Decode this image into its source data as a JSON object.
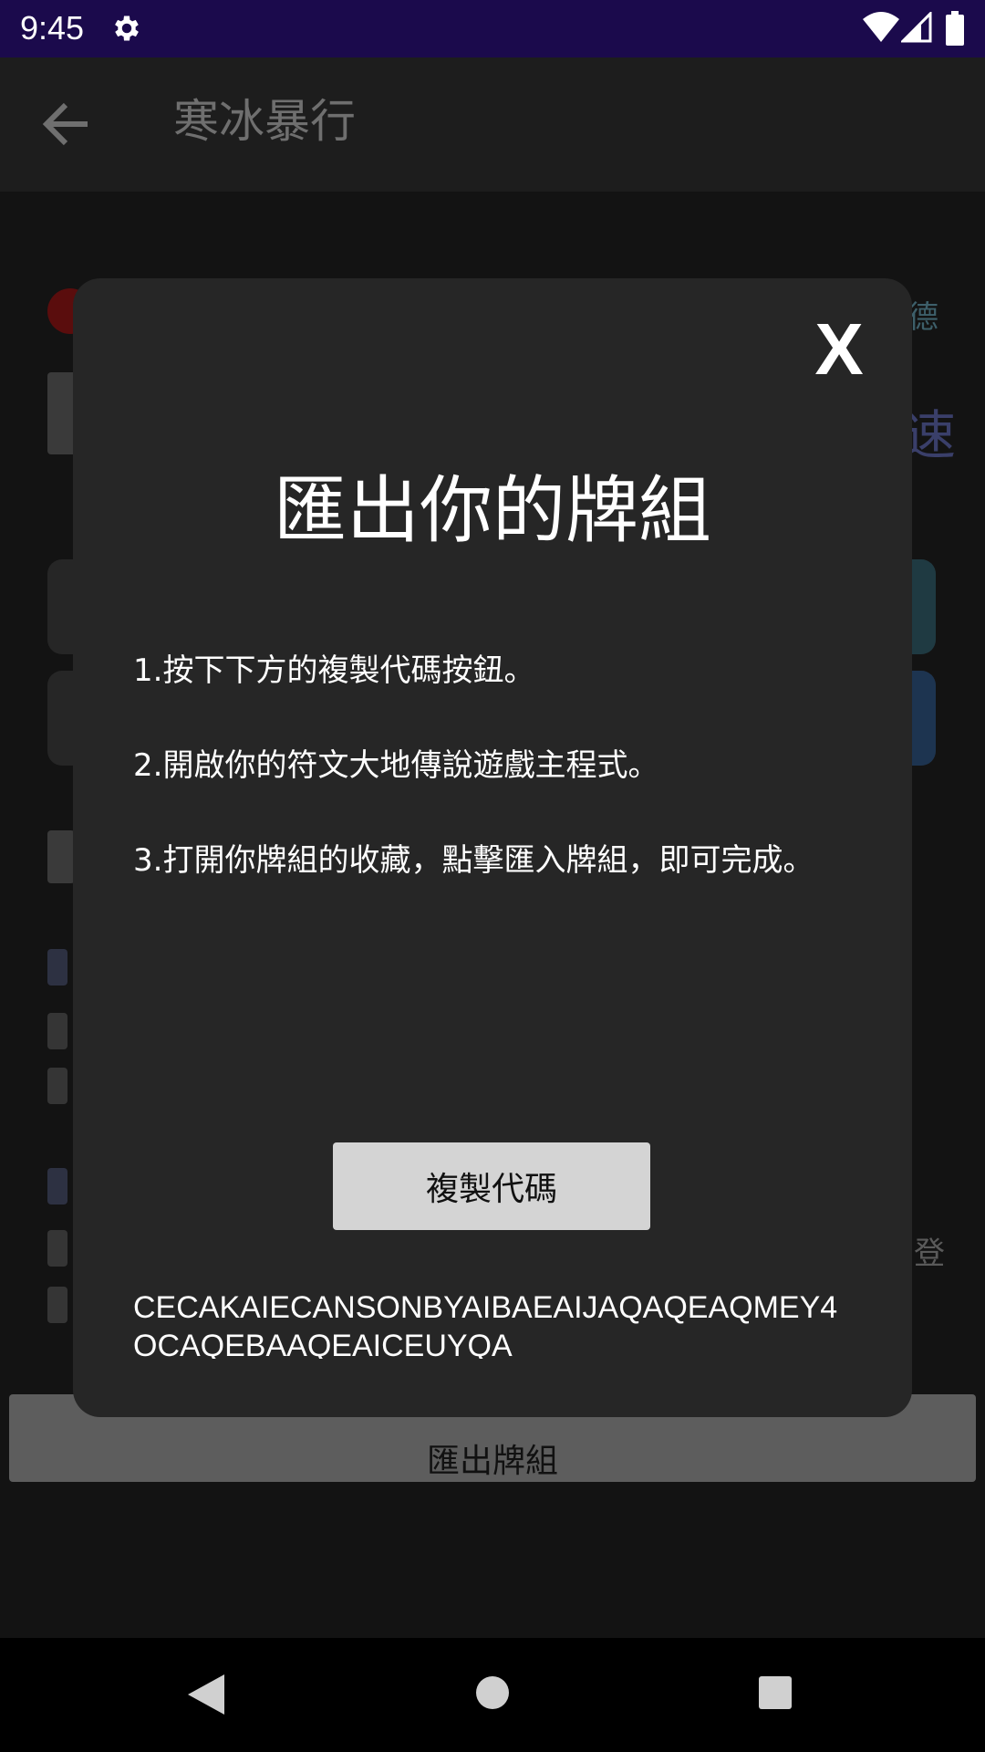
{
  "status_bar": {
    "time": "9:45",
    "icons": [
      "settings-gear-icon",
      "wifi-icon",
      "cell-signal-icon",
      "battery-icon"
    ]
  },
  "app_bar": {
    "title": "寒冰暴行",
    "back_icon": "arrow-left-icon"
  },
  "background": {
    "right_label": "德",
    "right_char": "速",
    "right_tail": "登",
    "export_button_label": "匯出牌組"
  },
  "dialog": {
    "close_label": "X",
    "title": "匯出你的牌組",
    "steps": [
      "1.按下下方的複製代碼按鈕。",
      "2.開啟你的符文大地傳說遊戲主程式。",
      "3.打開你牌組的收藏，點擊匯入牌組，即可完成。"
    ],
    "copy_button_label": "複製代碼",
    "deck_code": "CECAKAIECANSONBYAIBAEAIJAQAQEAQMEY4OCAQEBAAQEAICEUYQA"
  },
  "nav_bar": {
    "icons": [
      "back-triangle-icon",
      "home-circle-icon",
      "recents-square-icon"
    ]
  },
  "colors": {
    "status_bar": "#1b0a4c",
    "dialog_bg": "#262626",
    "copy_button_bg": "#d4d4d4"
  }
}
